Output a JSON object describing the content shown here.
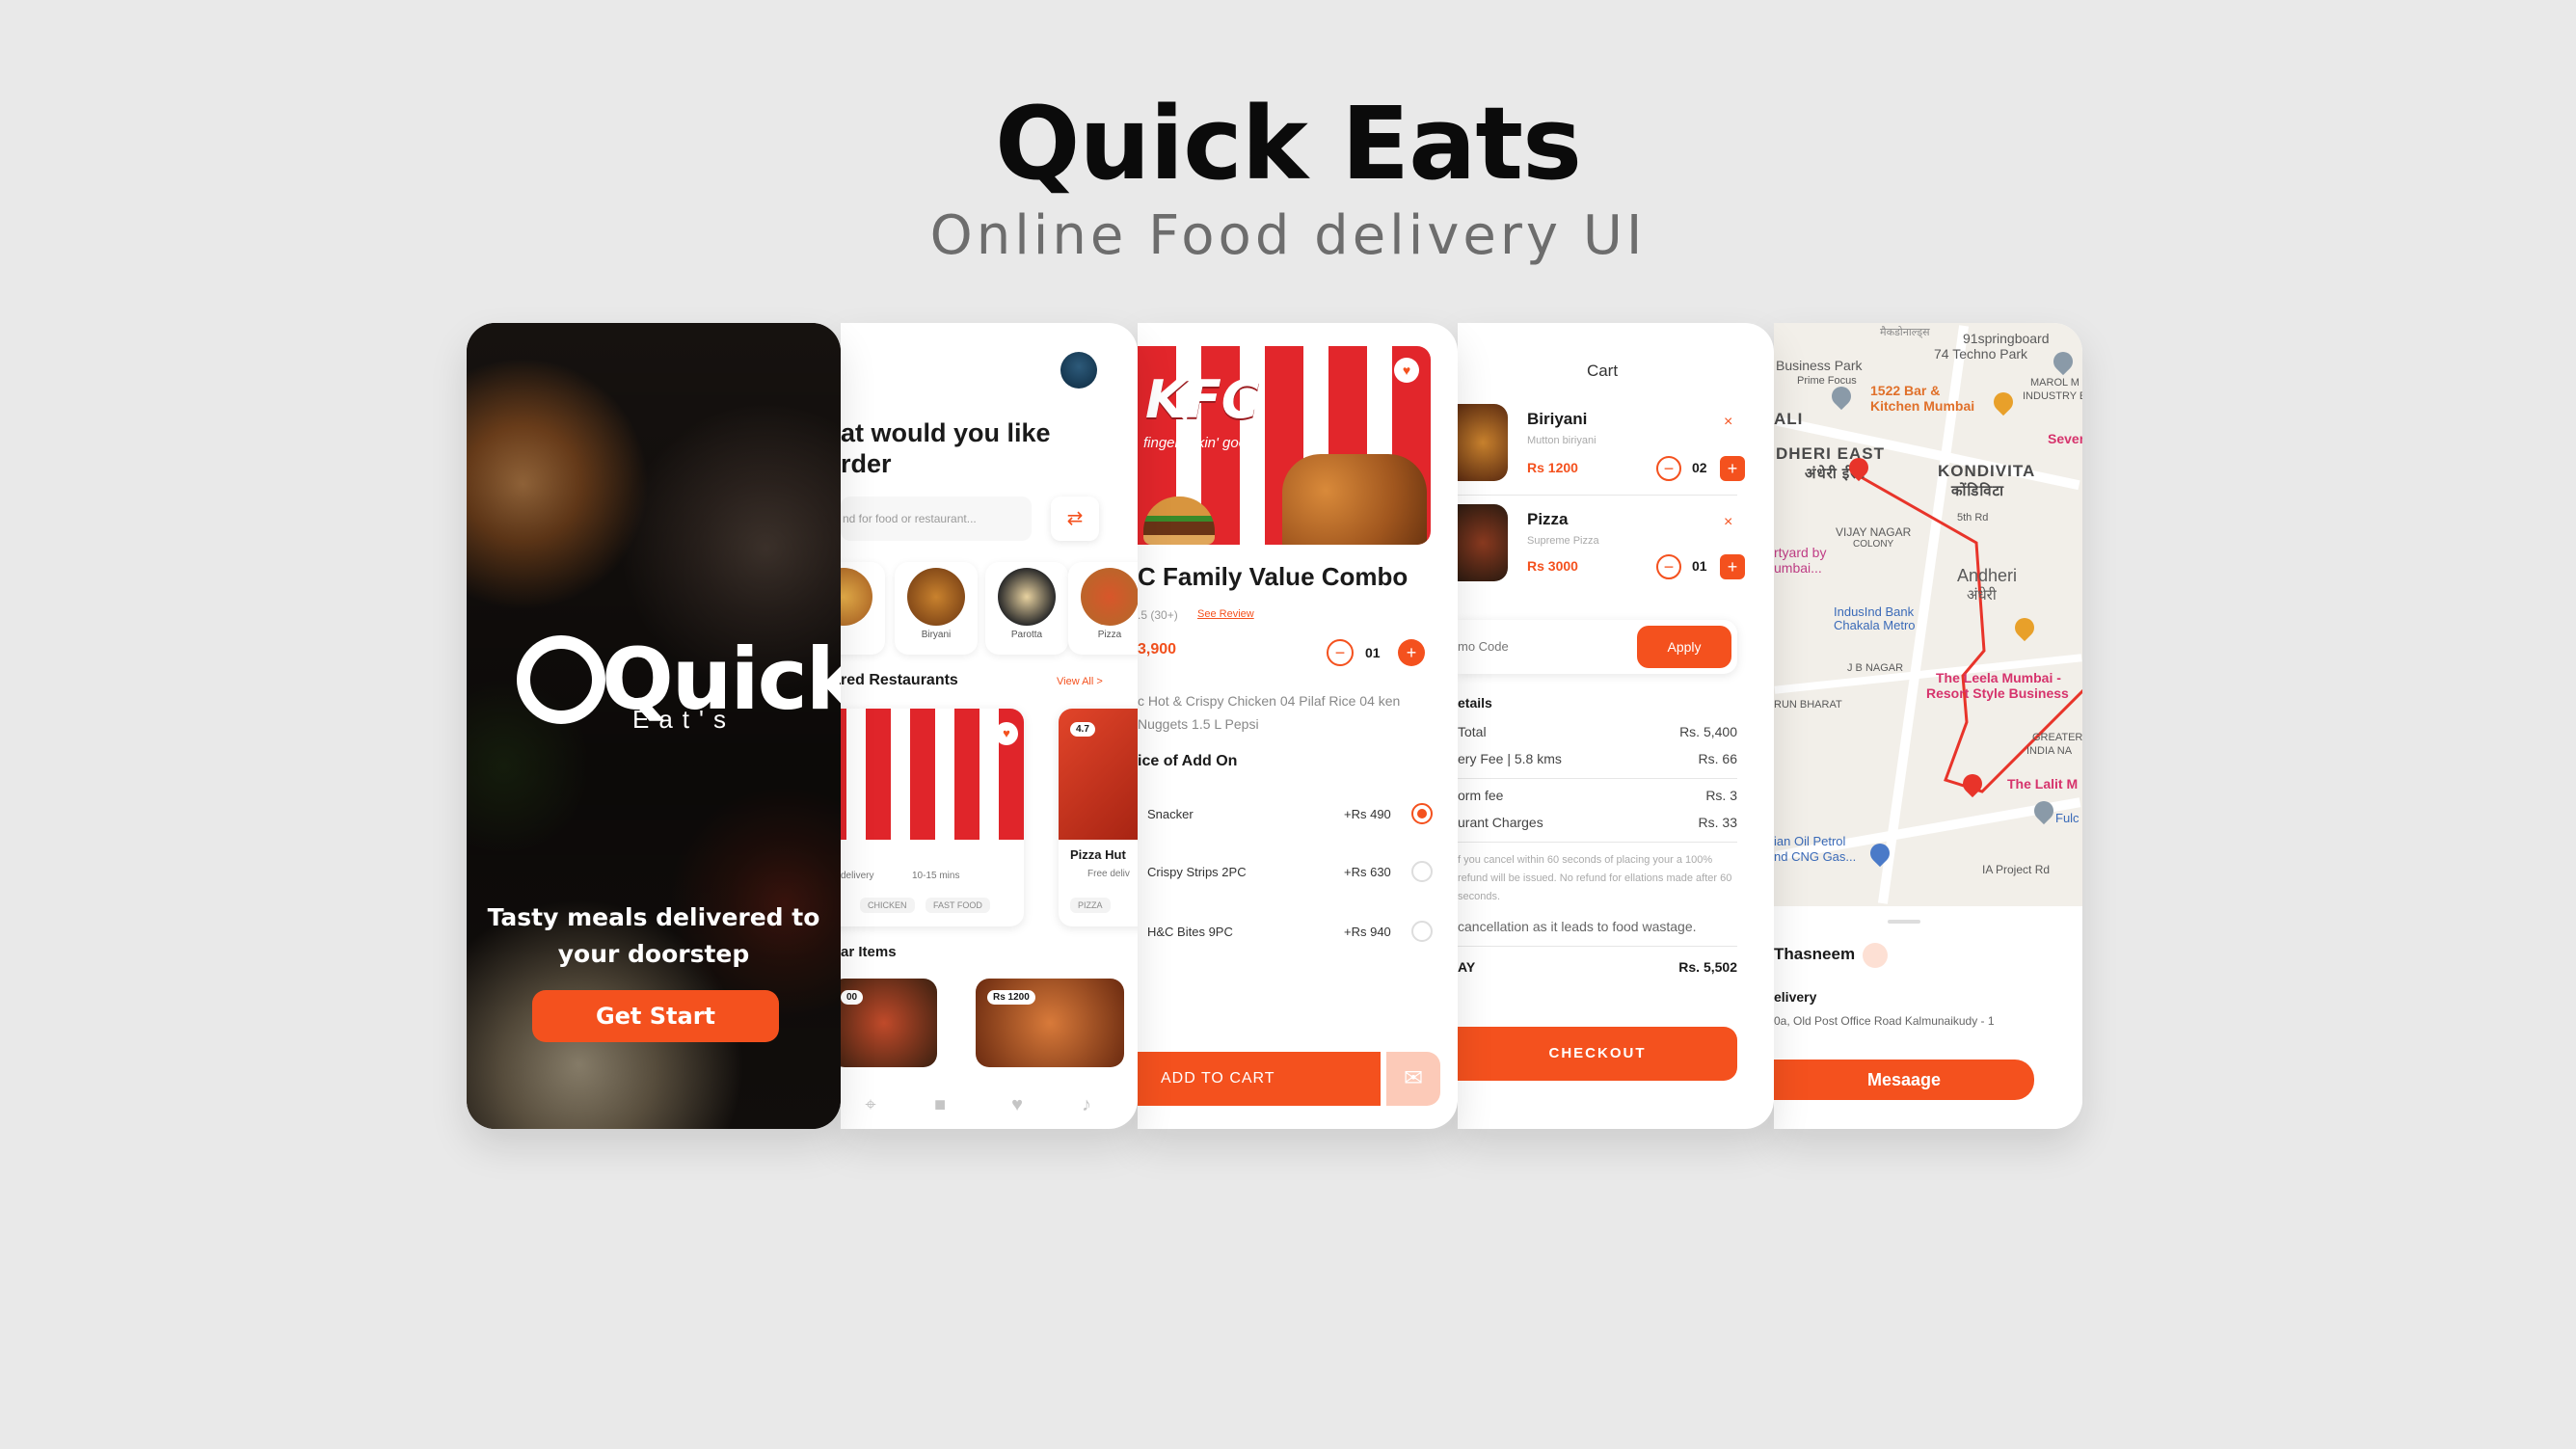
{
  "header": {
    "title": "Quick Eats",
    "subtitle": "Online Food delivery UI"
  },
  "splash": {
    "logo_word": "Quick",
    "logo_sub": "Eat's",
    "tagline": "Tasty meals delivered to your doorstep",
    "cta": "Get Start"
  },
  "home": {
    "heading": "at would you like\nrder",
    "search_placeholder": "nd for food or restaurant...",
    "categories": [
      {
        "label": ""
      },
      {
        "label": "Biryani"
      },
      {
        "label": "Parotta"
      },
      {
        "label": "Pizza"
      }
    ],
    "featured_title": "red Restaurants",
    "view_all": "View All >",
    "restaurants": [
      {
        "name": "",
        "delivery": "delivery",
        "time": "10-15 mins",
        "tags": [
          "CHICKEN",
          "FAST FOOD"
        ]
      },
      {
        "name": "Pizza Hut",
        "rating": "4.7",
        "delivery": "Free deliv",
        "tags": [
          "PIZZA"
        ]
      }
    ],
    "popular_title": "ar Items",
    "popular": [
      {
        "price": "00"
      },
      {
        "price": "Rs 1200"
      }
    ]
  },
  "product": {
    "brand": "KFC",
    "slogan": "finger lickin' good",
    "title": "C Family Value Combo",
    "rating": ".5",
    "rating_count": "(30+)",
    "see_review": "See Review",
    "price": "3,900",
    "qty": "01",
    "description": "c Hot & Crispy Chicken 04 Pilaf Rice 04 ken Nuggets 1.5 L Pepsi",
    "addon_title": "ice of Add On",
    "addons": [
      {
        "name": "Snacker",
        "price": "+Rs 490",
        "selected": true
      },
      {
        "name": "Crispy Strips 2PC",
        "price": "+Rs 630",
        "selected": false
      },
      {
        "name": "H&C Bites 9PC",
        "price": "+Rs 940",
        "selected": false
      }
    ],
    "add_to_cart": "ADD TO CART"
  },
  "cart": {
    "title": "Cart",
    "items": [
      {
        "name": "Biriyani",
        "sub": "Mutton biriyani",
        "price": "Rs 1200",
        "qty": "02"
      },
      {
        "name": "Pizza",
        "sub": "Supreme Pizza",
        "price": "Rs 3000",
        "qty": "01"
      }
    ],
    "promo_placeholder": "mo Code",
    "apply": "Apply",
    "details_title": "etails",
    "lines": [
      {
        "label": "Total",
        "value": "Rs. 5,400"
      },
      {
        "label": "ery Fee | 5.8 kms",
        "value": "Rs. 66"
      },
      {
        "label": "orm fee",
        "value": "Rs. 3"
      },
      {
        "label": "urant Charges",
        "value": "Rs. 33"
      }
    ],
    "note": "f you cancel within 60 seconds of placing your a 100% refund will be issued. No refund for ellations made after 60 seconds.",
    "note2": "cancellation as it leads to food wastage.",
    "total_label": "AY",
    "total_value": "Rs. 5,502",
    "checkout": "CHECKOUT"
  },
  "tracking": {
    "map_labels": {
      "top": "मैकडोनाल्ड्स",
      "springboard": "91springboard",
      "techno": "74 Techno Park",
      "business_park": "Business Park",
      "prime_focus": "Prime Focus",
      "bar": "1522 Bar &",
      "kitchen": "Kitchen Mumbai",
      "marol": "MAROL M",
      "industry": "INDUSTRY E",
      "ali": "ALI",
      "andheri_east": "DHERI EAST",
      "andheri_east_hi": "अंधेरी ईस्ट",
      "kondivita": "KONDIVITA",
      "kondivita_hi": "कोंडिविटा",
      "seven": "Sever",
      "fifth": "5th Rd",
      "vijay": "VIJAY NAGAR",
      "colony": "COLONY",
      "andheri": "Andheri",
      "andheri_hi": "अंधेरी",
      "courtyard": "rtyard by",
      "mumbai": "umbai...",
      "indusind": "IndusInd Bank",
      "chakala": "Chakala Metro",
      "jb": "J B NAGAR",
      "leela": "The Leela Mumbai -",
      "resort": "Resort Style Business",
      "arun": "RUN BHARAT",
      "greater": "GREATER",
      "india": "INDIA NA",
      "lalit": "The Lalit M",
      "oil": "ian Oil Petrol",
      "cng": "nd CNG Gas...",
      "ia": "IA Project Rd",
      "ful": "Fulc"
    },
    "driver": "Thasneem",
    "delivery_title": "elivery",
    "address": "0a, Old Post Office Road Kalmunaikudy - 1",
    "message": "Mesaage"
  },
  "colors": {
    "accent": "#f4511e",
    "background": "#e9e9e9"
  },
  "icons": [
    "heart-icon",
    "filter-icon",
    "location-icon",
    "bag-icon",
    "bell-icon",
    "cart-icon",
    "close-icon",
    "plus-icon",
    "minus-icon"
  ]
}
